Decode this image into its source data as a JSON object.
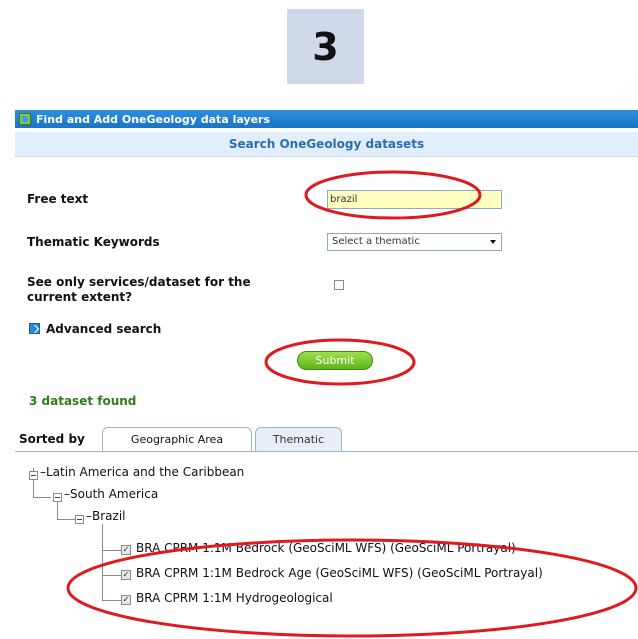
{
  "step_number": "3",
  "window": {
    "title": "Find and Add OneGeology data layers"
  },
  "search": {
    "header": "Search OneGeology datasets",
    "free_text_label": "Free text",
    "free_text_value": "brazil",
    "thematic_label": "Thematic Keywords",
    "thematic_selected": "Select a thematic",
    "extent_label_line1": "See only services/dataset for the",
    "extent_label_line2": "current extent?",
    "extent_checked": false,
    "advanced_label": "Advanced search",
    "submit_label": "Submit"
  },
  "results": {
    "found_text": "3  dataset found",
    "sorted_by_label": "Sorted by",
    "tabs": [
      "Geographic Area",
      "Thematic"
    ],
    "active_tab": "Geographic Area",
    "tree": {
      "region": "Latin America and the Caribbean",
      "subregion": "South America",
      "country": "Brazil",
      "datasets": [
        {
          "label": "BRA CPRM 1:1M Bedrock (GeoSciML WFS) (GeoSciML Portrayal)",
          "checked": true
        },
        {
          "label": "BRA CPRM 1:1M Bedrock Age (GeoSciML WFS) (GeoSciML Portrayal)",
          "checked": true
        },
        {
          "label": "BRA CPRM 1:1M Hydrogeological",
          "checked": true
        }
      ]
    }
  },
  "colors": {
    "annotation": "#e0191e",
    "title_bar": "#1f7fd4",
    "submit": "#6cc021",
    "found_text": "#2f7d1f"
  }
}
